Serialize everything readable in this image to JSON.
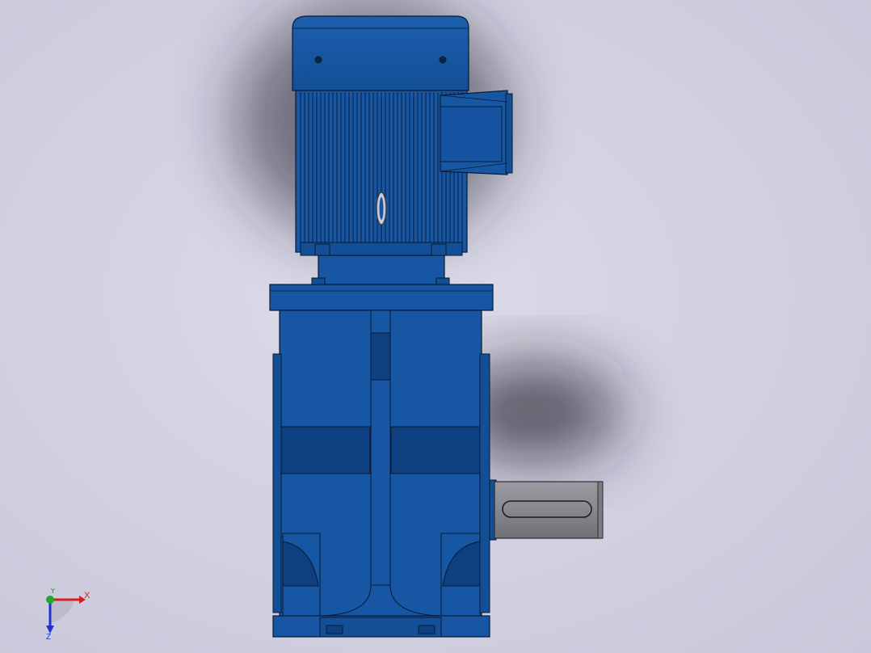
{
  "viewport": {
    "background_top": "#dcdbe8",
    "background_bottom": "#c9c8da",
    "model": {
      "body_color": "#1656a3",
      "body_dark": "#0e3f80",
      "edge_color": "#0a1a33",
      "shaft_color": "#8e9096"
    }
  },
  "triad": {
    "x_label": "X",
    "y_label": "Y",
    "z_label": "Z",
    "x_color": "#d42020",
    "y_color": "#1fa82a",
    "z_color": "#2233cc"
  }
}
